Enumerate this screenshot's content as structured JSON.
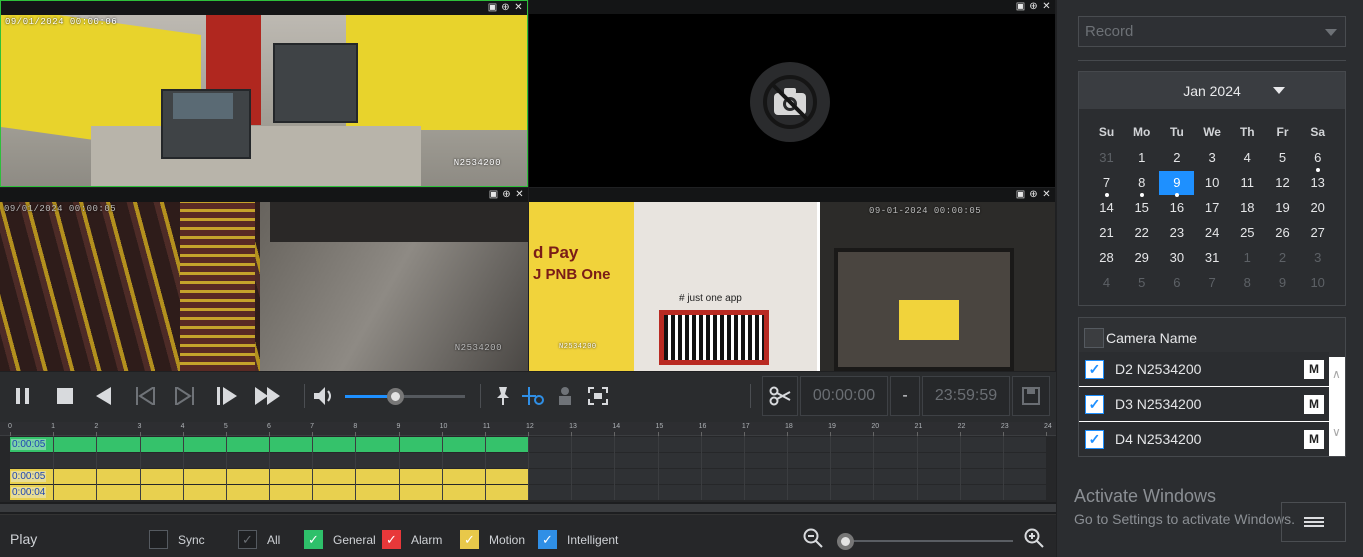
{
  "cameras": [
    {
      "id": "cam1",
      "osd_time": "09/01/2024 00:00:06",
      "osd_name": "N2534200",
      "active": true
    },
    {
      "id": "cam2",
      "no_video": true
    },
    {
      "id": "cam3",
      "osd_time": "09/01/2024 00:00:05",
      "osd_name": "N2534200"
    },
    {
      "id": "cam4",
      "osd_time": "09-01-2024 00:00:05",
      "osd_name": "N2534200",
      "ad_text_1": "d Pay",
      "ad_text_2": "J PNB One",
      "ad_text_3": "# just one app"
    }
  ],
  "pane_icons": [
    "snapshot-icon",
    "zoom-icon",
    "close-icon"
  ],
  "controls": {
    "volume_level": 0.42,
    "clip_start": "00:00:00",
    "clip_sep": "-",
    "clip_end": "23:59:59"
  },
  "timeline": {
    "hours": [
      "0",
      "1",
      "2",
      "3",
      "4",
      "5",
      "6",
      "7",
      "8",
      "9",
      "10",
      "11",
      "12",
      "13",
      "14",
      "15",
      "16",
      "17",
      "18",
      "19",
      "20",
      "21",
      "22",
      "23",
      "24"
    ],
    "rows": [
      {
        "label": "0:00:05",
        "color": "g"
      },
      {
        "label": "",
        "color": "empty"
      },
      {
        "label": "0:00:05",
        "color": "y"
      },
      {
        "label": "0:00:04",
        "color": "y"
      }
    ],
    "recorded_until_hour": 12
  },
  "legend": {
    "play_label": "Play",
    "sync_label": "Sync",
    "all_label": "All",
    "general_label": "General",
    "alarm_label": "Alarm",
    "motion_label": "Motion",
    "intelligent_label": "Intelligent",
    "general_color": "#2ec06a",
    "alarm_color": "#e8383a",
    "motion_color": "#e8c84a",
    "intelligent_color": "#2f8fe6"
  },
  "right_panel": {
    "record_select": "Record",
    "calendar": {
      "month_label": "Jan 2024",
      "weekdays": [
        "Su",
        "Mo",
        "Tu",
        "We",
        "Th",
        "Fr",
        "Sa"
      ],
      "weeks": [
        [
          "31",
          "1",
          "2",
          "3",
          "4",
          "5",
          "6"
        ],
        [
          "7",
          "8",
          "9",
          "10",
          "11",
          "12",
          "13"
        ],
        [
          "14",
          "15",
          "16",
          "17",
          "18",
          "19",
          "20"
        ],
        [
          "21",
          "22",
          "23",
          "24",
          "25",
          "26",
          "27"
        ],
        [
          "28",
          "29",
          "30",
          "31",
          "1",
          "2",
          "3"
        ],
        [
          "4",
          "5",
          "6",
          "7",
          "8",
          "9",
          "10"
        ]
      ],
      "selected_day": "9",
      "days_with_records": [
        "6",
        "7",
        "8",
        "9"
      ]
    },
    "camera_list": {
      "header": "Camera Name",
      "items": [
        {
          "name": "D2 N2534200",
          "checked": true,
          "badge": "M"
        },
        {
          "name": "D3 N2534200",
          "checked": true,
          "badge": "M"
        },
        {
          "name": "D4 N2534200",
          "checked": true,
          "badge": "M"
        }
      ]
    },
    "watermark_title": "Activate Windows",
    "watermark_sub": "Go to Settings to activate Windows."
  }
}
